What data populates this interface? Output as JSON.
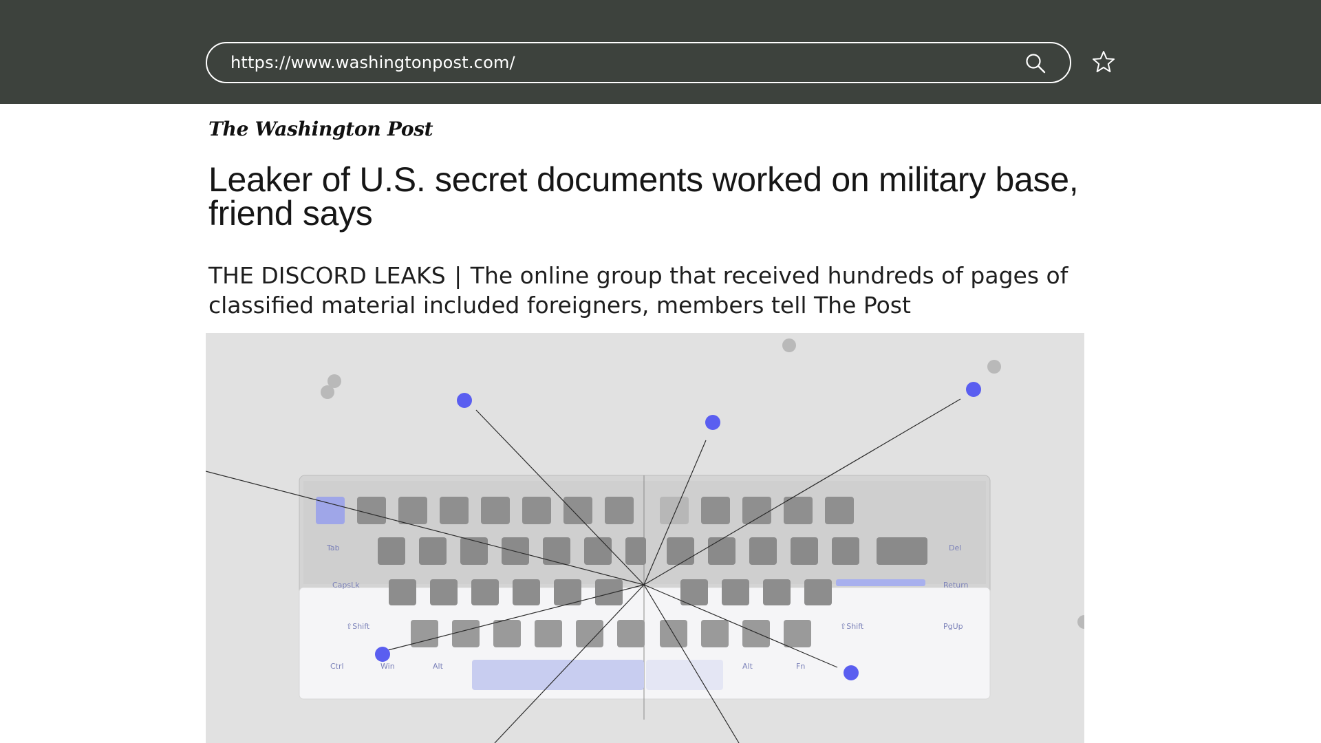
{
  "browser": {
    "url": "https://www.washingtonpost.com/"
  },
  "site": {
    "logo_text": "The Washington Post"
  },
  "article": {
    "headline": "Leaker of U.S. secret documents worked on military base, friend says",
    "kicker": "THE DISCORD LEAKS",
    "separator": "|",
    "dek": "The online group that received hundreds of pages of classified material included foreigners, members tell The Post"
  },
  "image": {
    "background_color": "#e1e1e1",
    "node_color": "#5a5ef0",
    "keyboard_labels": {
      "tab": "Tab",
      "capslock": "CapsLk",
      "shift_left": "⇧Shift",
      "shift_right": "⇧Shift",
      "ctrl": "Ctrl",
      "win": "Win",
      "alt_left": "Alt",
      "alt_right": "Alt",
      "fn": "Fn",
      "del": "Del",
      "pgup": "PgUp",
      "return": "Return"
    }
  },
  "icons": {
    "search": "search-icon",
    "bookmark": "star-icon"
  }
}
